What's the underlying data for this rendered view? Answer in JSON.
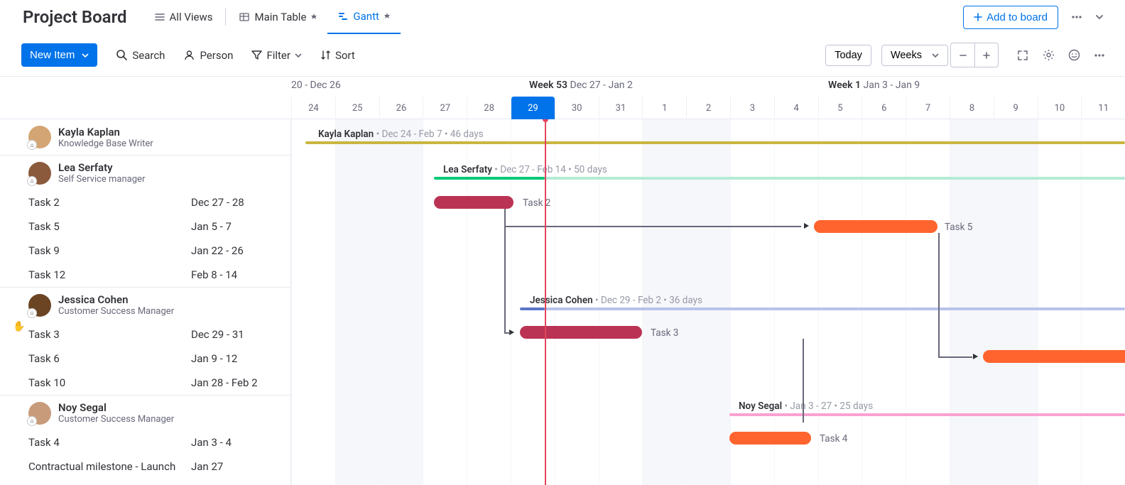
{
  "header": {
    "title": "Project Board",
    "allViews": "All Views",
    "mainTable": "Main Table",
    "gantt": "Gantt",
    "addToBoard": "Add to board"
  },
  "toolbar": {
    "newItem": "New Item",
    "search": "Search",
    "person": "Person",
    "filter": "Filter",
    "sort": "Sort",
    "today": "Today",
    "weeks": "Weeks"
  },
  "timeline": {
    "week52": "20 - Dec 26",
    "week53a": "Week 53",
    "week53b": "Dec 27 - Jan 2",
    "week1a": "Week 1",
    "week1b": "Jan 3 - Jan 9",
    "days": [
      "24",
      "25",
      "26",
      "27",
      "28",
      "29",
      "30",
      "31",
      "1",
      "2",
      "3",
      "4",
      "5",
      "6",
      "7",
      "8",
      "9",
      "10",
      "11"
    ]
  },
  "people": [
    {
      "name": "Kayla Kaplan",
      "role": "Knowledge Base Writer",
      "avatar": "#d4a574"
    },
    {
      "name": "Lea Serfaty",
      "role": "Self Service manager",
      "avatar": "#8b5a3c"
    },
    {
      "name": "Jessica Cohen",
      "role": "Customer Success Manager",
      "avatar": "#6b4423"
    },
    {
      "name": "Noy Segal",
      "role": "Customer Success Manager",
      "avatar": "#c89b7b"
    }
  ],
  "tasks_lea": [
    {
      "name": "Task 2",
      "dates": "Dec 27 - 28"
    },
    {
      "name": "Task 5",
      "dates": "Jan 5 - 7"
    },
    {
      "name": "Task 9",
      "dates": "Jan 22 - 26"
    },
    {
      "name": "Task 12",
      "dates": "Feb 8 - 14"
    }
  ],
  "tasks_jessica": [
    {
      "name": "Task 3",
      "dates": "Dec 29 - 31"
    },
    {
      "name": "Task 6",
      "dates": "Jan 9 - 12"
    },
    {
      "name": "Task 10",
      "dates": "Jan 28 - Feb 2"
    }
  ],
  "tasks_noy": [
    {
      "name": "Task 4",
      "dates": "Jan 3 - 4"
    },
    {
      "name": "Contractual milestone - Launch",
      "dates": "Jan 27"
    }
  ],
  "bars": {
    "kayla": {
      "label": "Kayla Kaplan",
      "range": "Dec 24 - Feb 7",
      "days": "46 days"
    },
    "lea": {
      "label": "Lea Serfaty",
      "range": "Dec 27 - Feb 14",
      "days": "50 days"
    },
    "jessica": {
      "label": "Jessica Cohen",
      "range": "Dec 29 - Feb 2",
      "days": "36 days"
    },
    "noy": {
      "label": "Noy Segal",
      "range": "Jan 3 - 27",
      "days": "25 days"
    },
    "task2": "Task 2",
    "task5": "Task 5",
    "task3": "Task 3",
    "task4": "Task 4"
  },
  "chart_data": {
    "type": "bar",
    "title": "Project Board Gantt",
    "time_unit": "days",
    "visible_range": [
      "Dec 24",
      "Jan 11"
    ],
    "today": "Dec 29",
    "groups": [
      {
        "person": "Kayla Kaplan",
        "start": "Dec 24",
        "end": "Feb 7",
        "duration_days": 46,
        "color": "#cab641"
      },
      {
        "person": "Lea Serfaty",
        "start": "Dec 27",
        "end": "Feb 14",
        "duration_days": 50,
        "color": "#00c875",
        "tasks": [
          {
            "name": "Task 2",
            "start": "Dec 27",
            "end": "Dec 28",
            "color": "#bb3354"
          },
          {
            "name": "Task 5",
            "start": "Jan 5",
            "end": "Jan 7",
            "color": "#ff642e"
          },
          {
            "name": "Task 9",
            "start": "Jan 22",
            "end": "Jan 26"
          },
          {
            "name": "Task 12",
            "start": "Feb 8",
            "end": "Feb 14"
          }
        ]
      },
      {
        "person": "Jessica Cohen",
        "start": "Dec 29",
        "end": "Feb 2",
        "duration_days": 36,
        "color": "#9aace5",
        "tasks": [
          {
            "name": "Task 3",
            "start": "Dec 29",
            "end": "Dec 31",
            "color": "#bb3354"
          },
          {
            "name": "Task 6",
            "start": "Jan 9",
            "end": "Jan 12",
            "color": "#ff642e"
          },
          {
            "name": "Task 10",
            "start": "Jan 28",
            "end": "Feb 2"
          }
        ]
      },
      {
        "person": "Noy Segal",
        "start": "Jan 3",
        "end": "Jan 27",
        "duration_days": 25,
        "color": "#faa1d1",
        "tasks": [
          {
            "name": "Task 4",
            "start": "Jan 3",
            "end": "Jan 4",
            "color": "#ff642e"
          },
          {
            "name": "Contractual milestone - Launch",
            "start": "Jan 27",
            "end": "Jan 27"
          }
        ]
      }
    ],
    "dependencies": [
      {
        "from": "Task 2",
        "to": "Task 5"
      },
      {
        "from": "Task 2",
        "to": "Task 3"
      },
      {
        "from": "Task 5",
        "to": "Task 6"
      },
      {
        "from": "Task 3",
        "to": "Task 4"
      }
    ]
  }
}
